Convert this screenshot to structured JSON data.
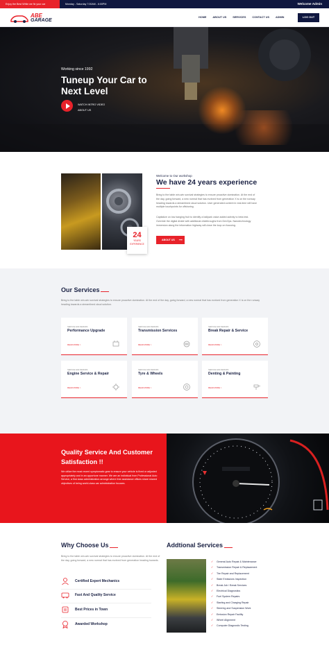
{
  "topbar": {
    "promo": "Enjoy the Best While we fix your car",
    "hours": "Monday - Saturday 7:00AM - 6:00PM",
    "welcome": "Welcome Admin"
  },
  "nav": {
    "logo_line1": "ABE",
    "logo_line2": "GARAGE",
    "menu": [
      "HOME",
      "ABOUT US",
      "SERVICES",
      "CONTACT US",
      "ADMIN"
    ],
    "logout": "LOG OUT"
  },
  "hero": {
    "eyebrow": "Working since 1992",
    "title": "Tuneup Your Car to Next Level",
    "watch_line1": "WATCH INTRO VIDEO",
    "watch_line2": "ABOUT US"
  },
  "about": {
    "eyebrow": "Welcome to Our workshop",
    "title": "We have 24 years experience",
    "para1": "Bring to the table win-win survival strategies to ensure proactive domination. At the end of the day, going forward, a new normal that has evolved from generation X is on the runway heading towards a streamlined cloud solution. User generated content in real-time will have multiple touchpoints for offshoring.",
    "para2": "Capitalize on low hanging fruit to identify a ballpark value added activity to beta test. Override the digital divide with additional clickthroughs from DevOps. Nanotechnology immersion along the information highway will close the loop on focusing.",
    "button": "ABOUT US",
    "badge_number": "24",
    "badge_line1": "YEARS",
    "badge_line2": "EXPERIENCE"
  },
  "services": {
    "title": "Our Services",
    "desc": "Bring to the table win-win survival strategies to ensure proactive domination. At the end of the day, going forward, a new normal that has evolved from generation X is on the runway heading towards a streamlined cloud solution.",
    "items": [
      {
        "small": "SERVICE AND REPAIRS",
        "title": "Performance Upgrade",
        "more": "READ MORE >",
        "icon": "engine-icon"
      },
      {
        "small": "SERVICE AND REPAIRS",
        "title": "Transmission Services",
        "more": "READ MORE >",
        "icon": "transmission-icon"
      },
      {
        "small": "SERVICE AND REPAIRS",
        "title": "Break Repair & Service",
        "more": "READ MORE >",
        "icon": "brake-disc-icon"
      },
      {
        "small": "SERVICE AND REPAIRS",
        "title": "Engine Service & Repair",
        "more": "READ MORE >",
        "icon": "engine-gear-icon"
      },
      {
        "small": "SERVICE AND REPAIRS",
        "title": "Tyre & Wheels",
        "more": "READ MORE >",
        "icon": "wheel-icon"
      },
      {
        "small": "SERVICE AND REPAIRS",
        "title": "Denting & Painting",
        "more": "READ MORE >",
        "icon": "spray-gun-icon"
      }
    ]
  },
  "quality": {
    "title": "Quality Service And Customer Satisfaction !!",
    "text": "We utilize the most recent symptomatic gear to ensure your vehicle is fixed or adjusted appropriately and in an opportune manner. We are an individual from Professional Auto Service, a first class administration arrange where free assistance offices share shared objectives of being world-class car administration focuses."
  },
  "why": {
    "title": "Why Choose Us",
    "desc": "Bring to the table win-win survival strategies to ensure proactive domination. At the end of the day, going forward, a new normal that has evolved from generation heading towards.",
    "features": [
      "Certified Expert Mechanics",
      "Fast And Quality Service",
      "Best Prices in Town",
      "Awarded Workshop"
    ]
  },
  "additional": {
    "title": "Addtional Services",
    "items": [
      "General Auto Repair & Maintenance",
      "Transmission Repair & Replacement",
      "Tire Repair and Replacement",
      "State Emissions Inspection",
      "Break Job / Break Services",
      "Electrical Diagnostics",
      "Fuel System Repairs",
      "Starting and Charging Repair",
      "Steering and Suspension Work",
      "Emission Repair Facility",
      "Wheel Alignment",
      "Computer Diagnostic Testing"
    ]
  },
  "colors": {
    "accent": "#e8222a",
    "navy": "#0f1740"
  }
}
